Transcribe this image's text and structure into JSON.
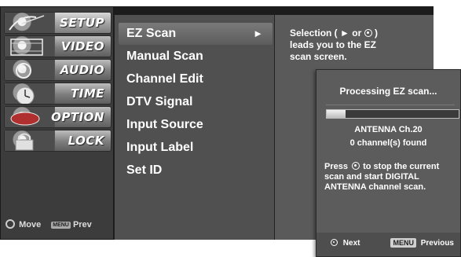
{
  "left_menu": {
    "items": [
      {
        "label": "SETUP",
        "icon": "satellite-dish-icon",
        "selected": true
      },
      {
        "label": "VIDEO",
        "icon": "film-reel-icon",
        "selected": false
      },
      {
        "label": "AUDIO",
        "icon": "speaker-icon",
        "selected": false
      },
      {
        "label": "TIME",
        "icon": "clock-icon",
        "selected": false
      },
      {
        "label": "OPTION",
        "icon": "option-icon",
        "selected": false
      },
      {
        "label": "LOCK",
        "icon": "padlock-icon",
        "selected": false
      }
    ],
    "footer": {
      "move_label": "Move",
      "menu_key": "MENU",
      "prev_label": "Prev"
    }
  },
  "sub_menu": {
    "items": [
      {
        "label": "EZ Scan",
        "arrow": "►",
        "highlighted": true
      },
      {
        "label": "Manual Scan",
        "highlighted": false
      },
      {
        "label": "Channel Edit",
        "highlighted": false
      },
      {
        "label": "DTV Signal",
        "highlighted": false
      },
      {
        "label": "Input Source",
        "highlighted": false
      },
      {
        "label": "Input Label",
        "highlighted": false
      },
      {
        "label": "Set ID",
        "highlighted": false
      }
    ]
  },
  "info": {
    "line1": "Selection (",
    "arrow": "►",
    "or": " or ",
    "line1_end": ")",
    "line2": "leads you to the EZ",
    "line3": "scan screen."
  },
  "popup": {
    "title": "Processing EZ scan...",
    "progress": 0.14,
    "antenna_status": "ANTENNA Ch.20",
    "found_status": "0 channel(s) found",
    "press_prefix": "Press",
    "press_suffix": "to stop the current scan and start DIGITAL ANTENNA channel scan.",
    "next_label": "Next",
    "menu_key": "MENU",
    "previous_label": "Previous"
  },
  "colors": {
    "panel_dark": "#3c3c3c",
    "panel_mid": "#505050",
    "highlight": "#6e6e6e",
    "text": "#ffffff"
  }
}
